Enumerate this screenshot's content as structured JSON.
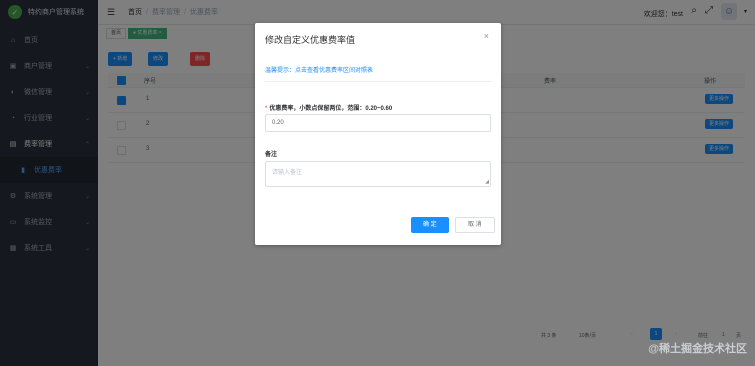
{
  "app": {
    "logo_text": "特约商户管理系统"
  },
  "sidebar": {
    "items": [
      {
        "label": "首页",
        "icon": "home-icon"
      },
      {
        "label": "商户管理",
        "icon": "store-icon"
      },
      {
        "label": "微信管理",
        "icon": "wechat-icon"
      },
      {
        "label": "行业管理",
        "icon": "industry-icon"
      },
      {
        "label": "费率管理",
        "icon": "rate-icon"
      },
      {
        "label": "优惠费率",
        "icon": "discount-icon"
      },
      {
        "label": "系统管理",
        "icon": "gear-icon"
      },
      {
        "label": "系统监控",
        "icon": "monitor-icon"
      },
      {
        "label": "系统工具",
        "icon": "tool-icon"
      }
    ]
  },
  "header": {
    "breadcrumb": [
      "首页",
      "费率管理",
      "优惠费率"
    ],
    "welcome": "欢迎您：test"
  },
  "tags": {
    "home": "首页",
    "active": "优惠费率"
  },
  "toolbar": {
    "add": "+ 新增",
    "edit": "修改",
    "delete": "删除"
  },
  "table": {
    "headers": [
      "序号",
      "费率",
      "操作"
    ],
    "rows": [
      {
        "index": "1",
        "action": "更多操作"
      },
      {
        "index": "2",
        "action": "更多操作"
      },
      {
        "index": "3",
        "action": "更多操作"
      }
    ]
  },
  "pagination": {
    "total": "共 3 条",
    "size": "10条/页",
    "current": "1",
    "goto_prefix": "前往",
    "goto_value": "1",
    "goto_suffix": "页"
  },
  "watermark": "@稀土掘金技术社区",
  "dialog": {
    "title": "修改自定义优惠费率值",
    "tip": "温馨提示：点击查看优惠费率区间对照表",
    "rate_label": "优惠费率，小数点保留两位，范围：0.20~0.60",
    "rate_value": "0.20",
    "remark_label": "备注",
    "remark_placeholder": "请输入备注",
    "confirm": "确 定",
    "cancel": "取 消"
  },
  "colors": {
    "primary": "#1890ff",
    "sidebar_bg": "#2b333e",
    "active_tag": "#42b983"
  }
}
